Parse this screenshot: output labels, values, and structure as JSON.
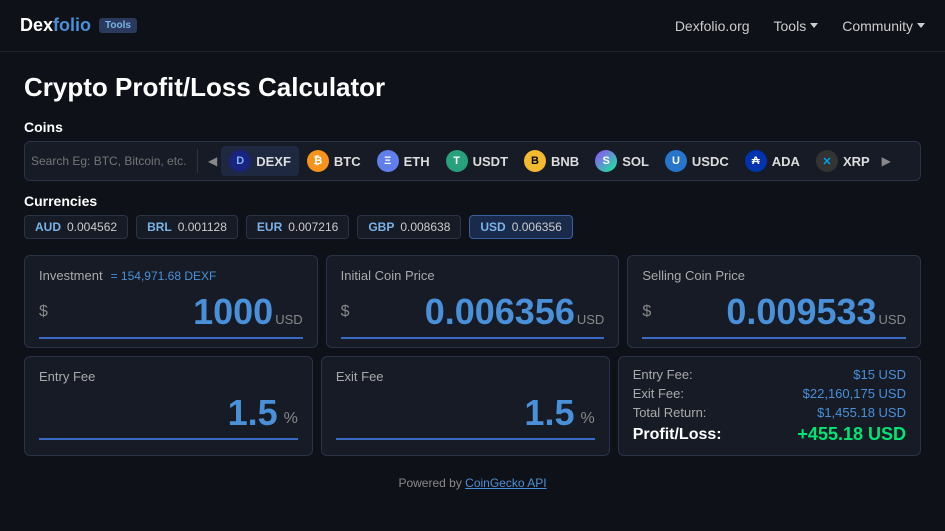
{
  "header": {
    "logo": "Dexfolio",
    "logo_accent": "folio",
    "tools_badge": "Tools",
    "nav": [
      {
        "label": "Dexfolio.org",
        "has_dropdown": false
      },
      {
        "label": "Tools",
        "has_dropdown": true
      },
      {
        "label": "Community",
        "has_dropdown": true
      }
    ]
  },
  "page": {
    "title": "Crypto Profit/Loss Calculator"
  },
  "coins_section": {
    "label": "Coins",
    "search_placeholder": "Search Eg: BTC, Bitcoin, etc.",
    "coins": [
      {
        "id": "dexf",
        "symbol": "DEXF",
        "icon_text": "D",
        "icon_class": "ic-dexf",
        "active": true
      },
      {
        "id": "btc",
        "symbol": "BTC",
        "icon_text": "₿",
        "icon_class": "ic-btc",
        "active": false
      },
      {
        "id": "eth",
        "symbol": "ETH",
        "icon_text": "Ξ",
        "icon_class": "ic-eth",
        "active": false
      },
      {
        "id": "usdt",
        "symbol": "USDT",
        "icon_text": "T",
        "icon_class": "ic-usdt",
        "active": false
      },
      {
        "id": "bnb",
        "symbol": "BNB",
        "icon_text": "B",
        "icon_class": "ic-bnb",
        "active": false
      },
      {
        "id": "sol",
        "symbol": "SOL",
        "icon_text": "S",
        "icon_class": "ic-sol",
        "active": false
      },
      {
        "id": "usdc",
        "symbol": "USDC",
        "icon_text": "U",
        "icon_class": "ic-usdc",
        "active": false
      },
      {
        "id": "ada",
        "symbol": "ADA",
        "icon_text": "₳",
        "icon_class": "ic-ada",
        "active": false
      },
      {
        "id": "xrp",
        "symbol": "XRP",
        "icon_text": "✕",
        "icon_class": "ic-xrp",
        "active": false
      }
    ]
  },
  "currencies_section": {
    "label": "Currencies",
    "currencies": [
      {
        "code": "AUD",
        "value": "0.004562",
        "active": false
      },
      {
        "code": "BRL",
        "value": "0.001128",
        "active": false
      },
      {
        "code": "EUR",
        "value": "0.007216",
        "active": false
      },
      {
        "code": "GBP",
        "value": "0.008638",
        "active": false
      },
      {
        "code": "USD",
        "value": "0.006356",
        "active": true
      }
    ]
  },
  "calculator": {
    "investment": {
      "label": "Investment",
      "equiv": "= 154,971.68 DEXF",
      "currency_symbol": "$",
      "value": "1000",
      "unit": "USD"
    },
    "initial_price": {
      "label": "Initial Coin Price",
      "currency_symbol": "$",
      "value": "0.006356",
      "unit": "USD"
    },
    "selling_price": {
      "label": "Selling Coin Price",
      "currency_symbol": "$",
      "value": "0.009533",
      "unit": "USD"
    },
    "entry_fee": {
      "label": "Entry Fee",
      "value": "1.5",
      "unit": "%"
    },
    "exit_fee": {
      "label": "Exit Fee",
      "value": "1.5",
      "unit": "%"
    }
  },
  "results": {
    "entry_fee_label": "Entry Fee:",
    "entry_fee_value": "$15 USD",
    "exit_fee_label": "Exit Fee:",
    "exit_fee_value": "$22,160,175 USD",
    "total_return_label": "Total Return:",
    "total_return_value": "$1,455.18 USD",
    "profit_loss_label": "Profit/Loss:",
    "profit_loss_value": "+455.18 USD"
  },
  "footer": {
    "text": "Powered by ",
    "link_label": "CoinGecko API",
    "link_url": "#"
  }
}
